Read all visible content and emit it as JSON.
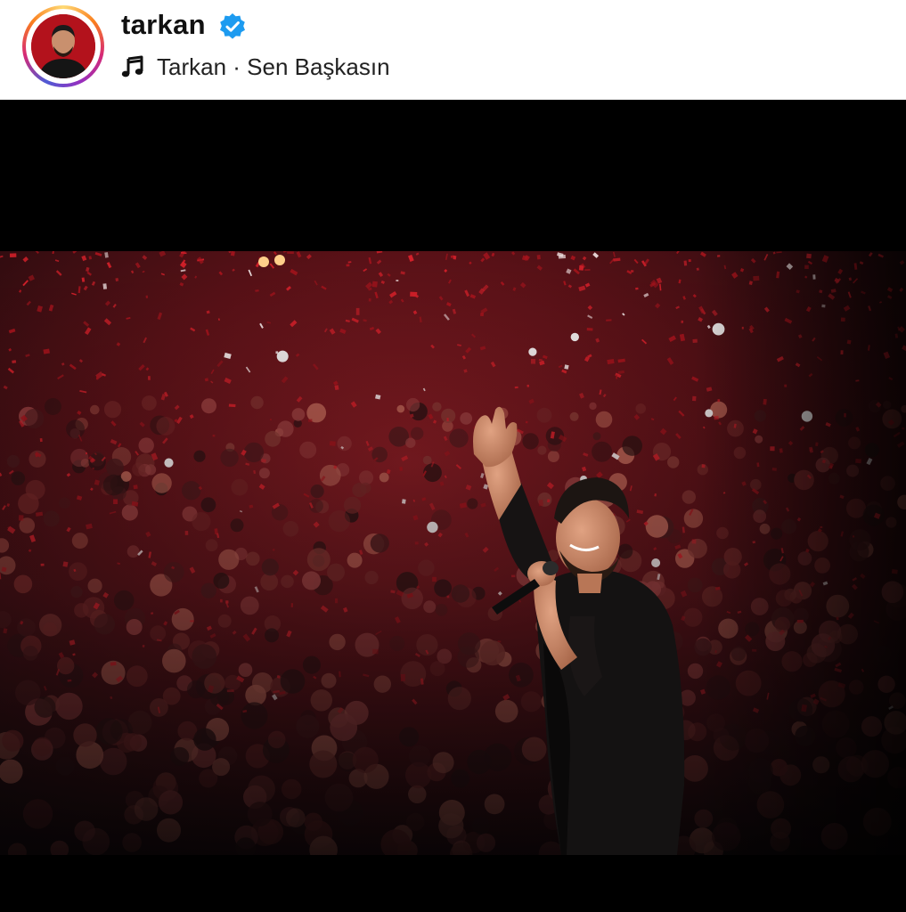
{
  "post": {
    "username": "tarkan",
    "verified": true,
    "audio": {
      "icon": "music-note-icon",
      "label": "Tarkan · Sen Başkasın"
    }
  },
  "colors": {
    "header_bg": "#ffffff",
    "verified_badge": "#1d9bf0",
    "letterbox": "#000000",
    "confetti": "#c3151f"
  }
}
